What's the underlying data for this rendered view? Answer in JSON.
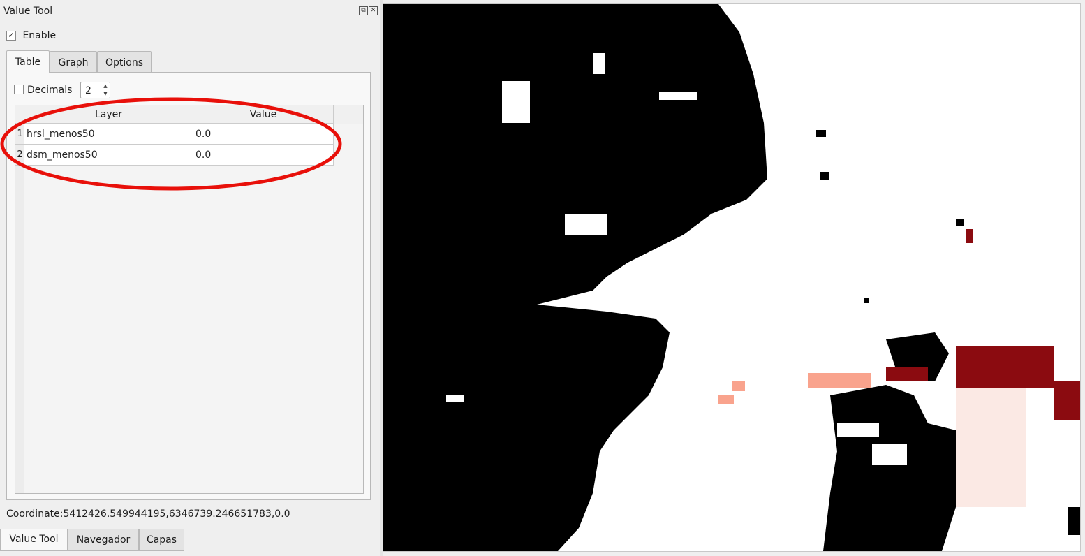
{
  "panel": {
    "title": "Value Tool",
    "float_icon": "float-icon",
    "close_icon": "close-icon",
    "enable_label": "Enable",
    "enable_checked": true,
    "tabs": [
      {
        "label": "Table",
        "active": true
      },
      {
        "label": "Graph",
        "active": false
      },
      {
        "label": "Options",
        "active": false
      }
    ],
    "decimals_label": "Decimals",
    "decimals_checked": false,
    "decimals_value": "2",
    "table": {
      "columns": [
        "Layer",
        "Value"
      ],
      "rows": [
        {
          "num": "1",
          "layer": "hrsl_menos50",
          "value": "0.0"
        },
        {
          "num": "2",
          "layer": "dsm_menos50",
          "value": "0.0"
        }
      ]
    },
    "coordinate": "Coordinate:5412426.549944195,6346739.246651783,0.0",
    "highlight_color": "#e8100a"
  },
  "bottom_tabs": [
    {
      "label": "Value Tool",
      "active": true
    },
    {
      "label": "Navegador",
      "active": false
    },
    {
      "label": "Capas",
      "active": false
    }
  ],
  "map": {
    "colors": {
      "background": "#ffffff",
      "dark": "#000000",
      "dark_red": "#8b0b10",
      "salmon": "#f9a38d",
      "pale_pink": "#fbe9e4"
    }
  }
}
